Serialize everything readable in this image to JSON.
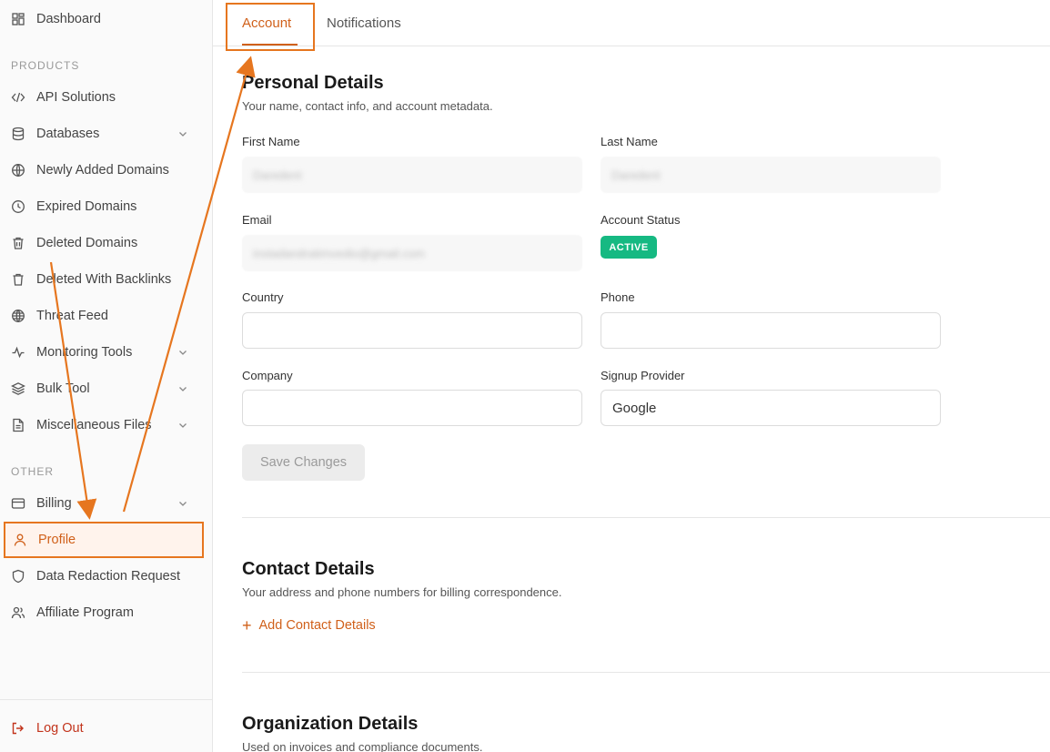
{
  "sidebar": {
    "items": [
      {
        "label": "Dashboard",
        "icon": "dashboard-icon"
      },
      {
        "label": "API Solutions",
        "icon": "code-icon"
      },
      {
        "label": "Databases",
        "icon": "database-icon"
      },
      {
        "label": "Newly Added Domains",
        "icon": "globe-icon"
      },
      {
        "label": "Expired Domains",
        "icon": "clock-icon"
      },
      {
        "label": "Deleted Domains",
        "icon": "trash-icon"
      },
      {
        "label": "Deleted With Backlinks",
        "icon": "trash-icon"
      },
      {
        "label": "Threat Feed",
        "icon": "globe-grid-icon"
      },
      {
        "label": "Monitoring Tools",
        "icon": "activity-icon"
      },
      {
        "label": "Bulk Tool",
        "icon": "layers-icon"
      },
      {
        "label": "Miscellaneous Files",
        "icon": "file-icon"
      },
      {
        "label": "Billing",
        "icon": "credit-card-icon"
      },
      {
        "label": "Profile",
        "icon": "user-icon"
      },
      {
        "label": "Data Redaction Request",
        "icon": "shield-icon"
      },
      {
        "label": "Affiliate Program",
        "icon": "users-icon"
      }
    ],
    "section_products": "PRODUCTS",
    "section_other": "OTHER",
    "logout": "Log Out"
  },
  "tabs": {
    "account": "Account",
    "notifications": "Notifications"
  },
  "personal": {
    "title": "Personal Details",
    "subtitle": "Your name, contact info, and account metadata.",
    "first_name_label": "First Name",
    "first_name_value": "Daredent",
    "last_name_label": "Last Name",
    "last_name_value": "Daredent",
    "email_label": "Email",
    "email_value": "instadandratimvedio@gmail.com",
    "status_label": "Account Status",
    "status_value": "ACTIVE",
    "country_label": "Country",
    "phone_label": "Phone",
    "company_label": "Company",
    "provider_label": "Signup Provider",
    "provider_value": "Google",
    "save_label": "Save Changes"
  },
  "contact": {
    "title": "Contact Details",
    "subtitle": "Your address and phone numbers for billing correspondence.",
    "add_label": "Add Contact Details"
  },
  "organization": {
    "title": "Organization Details",
    "subtitle": "Used on invoices and compliance documents."
  },
  "colors": {
    "accent": "#d0601a",
    "highlight": "#e6761f",
    "success": "#16b982",
    "danger": "#c2341c"
  }
}
